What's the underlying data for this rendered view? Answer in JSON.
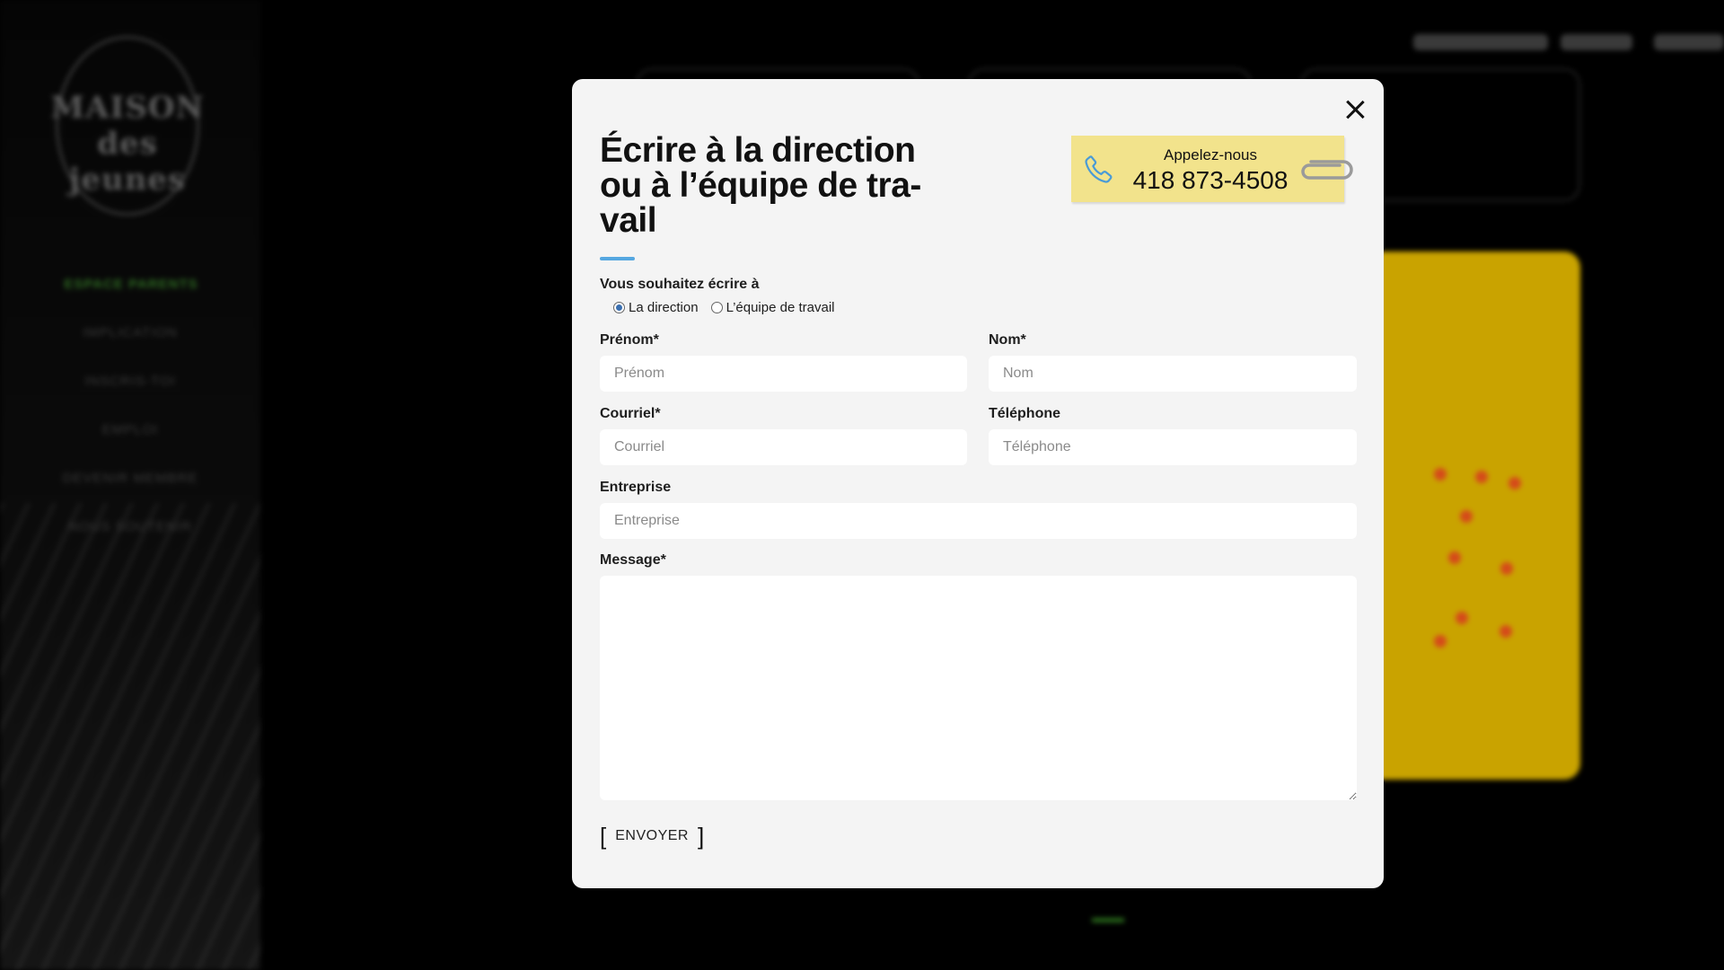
{
  "background": {
    "logo": {
      "line1": "MAISON",
      "line2": "des jeunes"
    },
    "nav_parents": "ESPACE PARENTS",
    "nav_items": [
      "IMPLICATION",
      "INSCRIS-TOI",
      "EMPLOI",
      "DEVENIR MEMBRE",
      "NOUS SOUTENIR"
    ],
    "colors": {
      "accent_green": "#2e6b22",
      "yellow_panel": "#c9a300",
      "dot": "#d54a1a"
    }
  },
  "modal": {
    "title": "Écrire à la direction ou à l’équipe de tra-vail",
    "accent_color": "#55a7e0",
    "close_icon": "close-icon",
    "phone": {
      "icon": "phone-icon",
      "label": "Appelez-nous",
      "number": "418 873-4508",
      "card_color": "#f2e38c"
    },
    "recipient": {
      "label": "Vous souhaitez écrire à",
      "options": [
        {
          "label": "La direction",
          "checked": true
        },
        {
          "label": "L’équipe de travail",
          "checked": false
        }
      ]
    },
    "fields": {
      "first_name": {
        "label": "Prénom*",
        "placeholder": "Prénom"
      },
      "last_name": {
        "label": "Nom*",
        "placeholder": "Nom"
      },
      "email": {
        "label": "Courriel*",
        "placeholder": "Courriel"
      },
      "phone": {
        "label": "Téléphone",
        "placeholder": "Téléphone"
      },
      "company": {
        "label": "Entreprise",
        "placeholder": "Entreprise"
      },
      "message": {
        "label": "Message*",
        "placeholder": ""
      }
    },
    "submit_label": "ENVOYER"
  }
}
